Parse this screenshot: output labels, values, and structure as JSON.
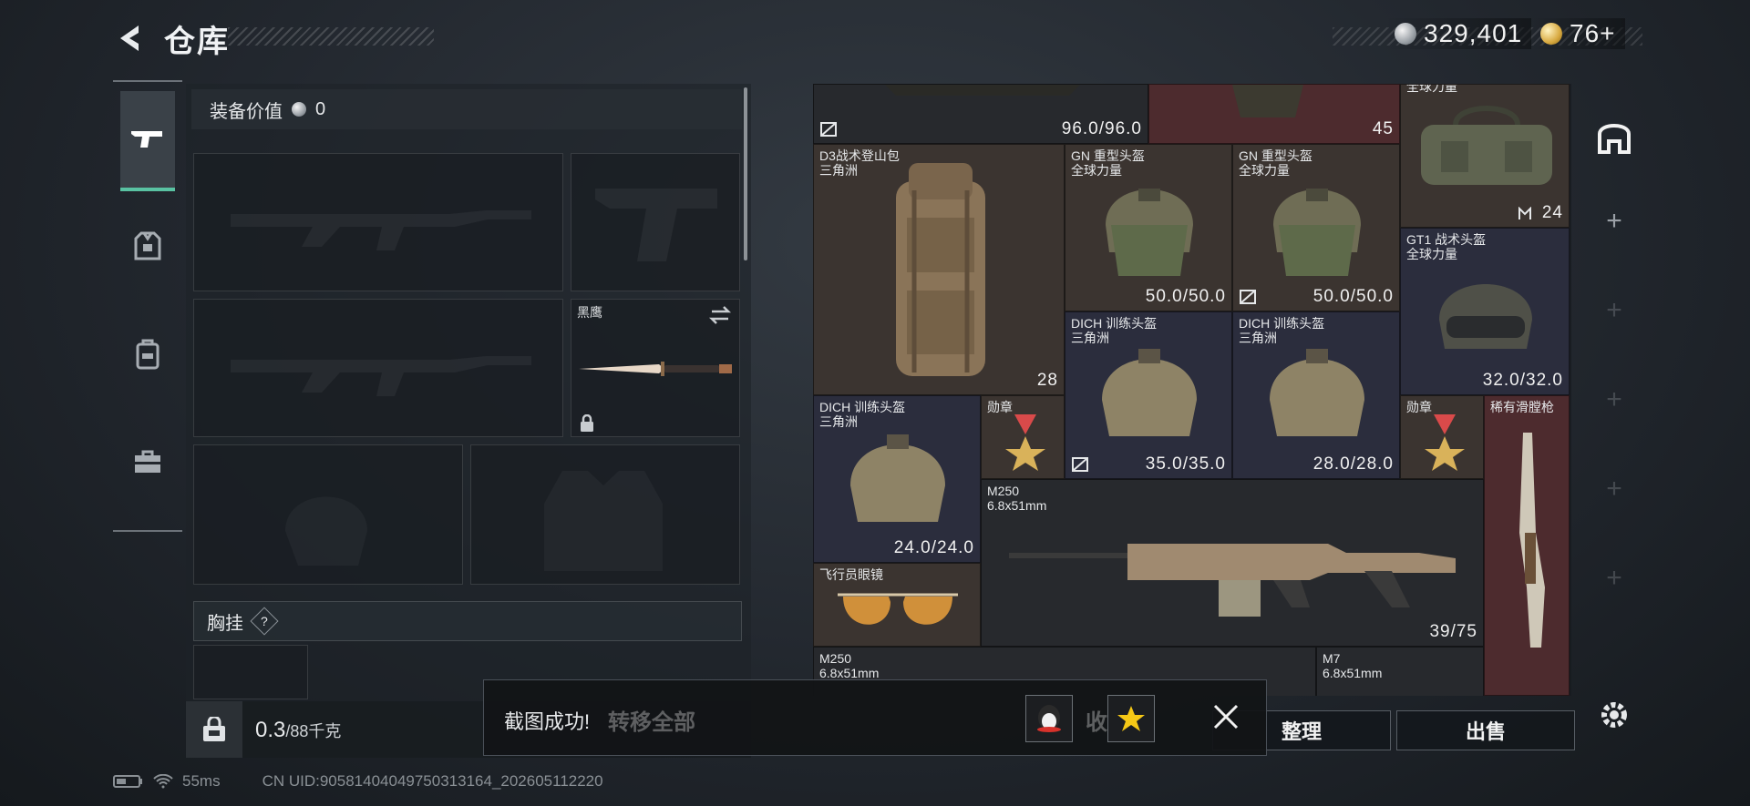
{
  "header": {
    "title": "仓库",
    "silver": "329,401",
    "gold": "76+"
  },
  "loadout": {
    "equip_value_label": "装备价值",
    "equip_value": "0",
    "melee_name": "黑鹰",
    "chest_label": "胸挂",
    "chest_help": "?",
    "weight_value": "0.3",
    "weight_max": "/88千克"
  },
  "status": {
    "ping": "55ms",
    "uid": "CN UID:9058140404975031316​4_202605112220"
  },
  "stash": {
    "items": [
      {
        "value": "96.0/96.0"
      },
      {
        "value": "45"
      },
      {
        "name1": "全球力量",
        "value": "24"
      },
      {
        "name1": "D3战术登山包",
        "name2": "三角洲",
        "value": "28"
      },
      {
        "name1": "GN 重型头盔",
        "name2": "全球力量",
        "value": "50.0/50.0"
      },
      {
        "name1": "GN 重型头盔",
        "name2": "全球力量",
        "value": "50.0/50.0"
      },
      {
        "name1": "GT1 战术头盔",
        "name2": "全球力量",
        "value": "32.0/32.0"
      },
      {
        "name1": "DICH 训练头盔",
        "name2": "三角洲",
        "value": "35.0/35.0"
      },
      {
        "name1": "DICH 训练头盔",
        "name2": "三角洲",
        "value": "28.0/28.0"
      },
      {
        "name1": "DICH 训练头盔",
        "name2": "三角洲",
        "value": "24.0/24.0"
      },
      {
        "name1": "勋章"
      },
      {
        "name1": "勋章"
      },
      {
        "name1": "稀有滑膛枪"
      },
      {
        "name1": "M250",
        "name2": "6.8x51mm",
        "value": "39/75"
      },
      {
        "name1": "飞行员眼镜"
      },
      {
        "name1": "M250",
        "name2": "6.8x51mm"
      },
      {
        "name1": "M7",
        "name2": "6.8x51mm"
      }
    ]
  },
  "toast": {
    "message": "截图成功!",
    "transfer_all": "转移全部",
    "collect": "收藏"
  },
  "actions": {
    "sort": "整理",
    "sell": "出售"
  }
}
